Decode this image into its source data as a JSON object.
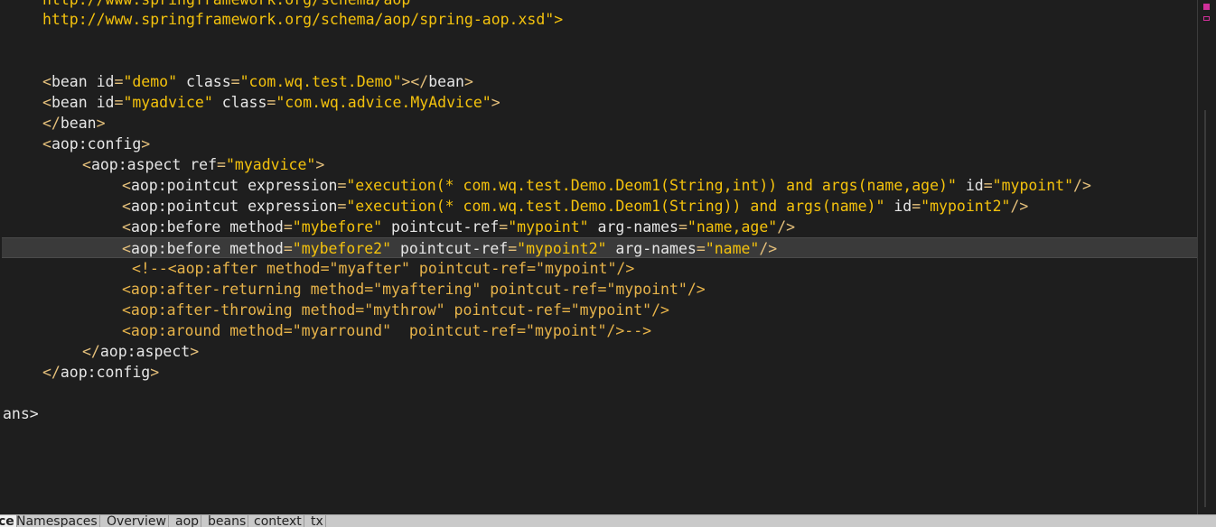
{
  "code": {
    "url1": "http://www.springframework.org/schema/aop",
    "url2": "http://www.springframework.org/schema/aop/spring-aop.xsd\">",
    "bean_demo": {
      "id": "\"demo\"",
      "class": "\"com.wq.test.Demo\""
    },
    "bean_advice": {
      "id": "\"myadvice\"",
      "class": "\"com.wq.advice.MyAdvice\""
    },
    "aspect_ref": "\"myadvice\"",
    "pointcut1": {
      "expression": "\"execution(* com.wq.test.Demo.Deom1(String,int)) and args(name,age)\"",
      "id": "\"mypoint\""
    },
    "pointcut2": {
      "expression": "\"execution(* com.wq.test.Demo.Deom1(String)) and args(name)\"",
      "id": "\"mypoint2\""
    },
    "before1": {
      "method": "\"mybefore\"",
      "ref": "\"mypoint\"",
      "args": "\"name,age\""
    },
    "before2": {
      "method": "\"mybefore2\"",
      "ref": "\"mypoint2\"",
      "args": "\"name\""
    },
    "comment1": "<!--<aop:after method=\"myafter\" pointcut-ref=\"mypoint\"/>",
    "comment2": "<aop:after-returning method=\"myaftering\" pointcut-ref=\"mypoint\"/>",
    "comment3": "<aop:after-throwing method=\"mythrow\" pointcut-ref=\"mypoint\"/>",
    "comment4": "<aop:around method=\"myarround\"  pointcut-ref=\"mypoint\"/>-->",
    "closing_beans": "ans>"
  },
  "tabs": [
    "ce",
    "Namespaces",
    "Overview",
    "aop",
    "beans",
    "context",
    "tx"
  ],
  "colors": {
    "background": "#1e1e1e",
    "value": "#f4c20d",
    "highlight": "#3a3a3a"
  }
}
